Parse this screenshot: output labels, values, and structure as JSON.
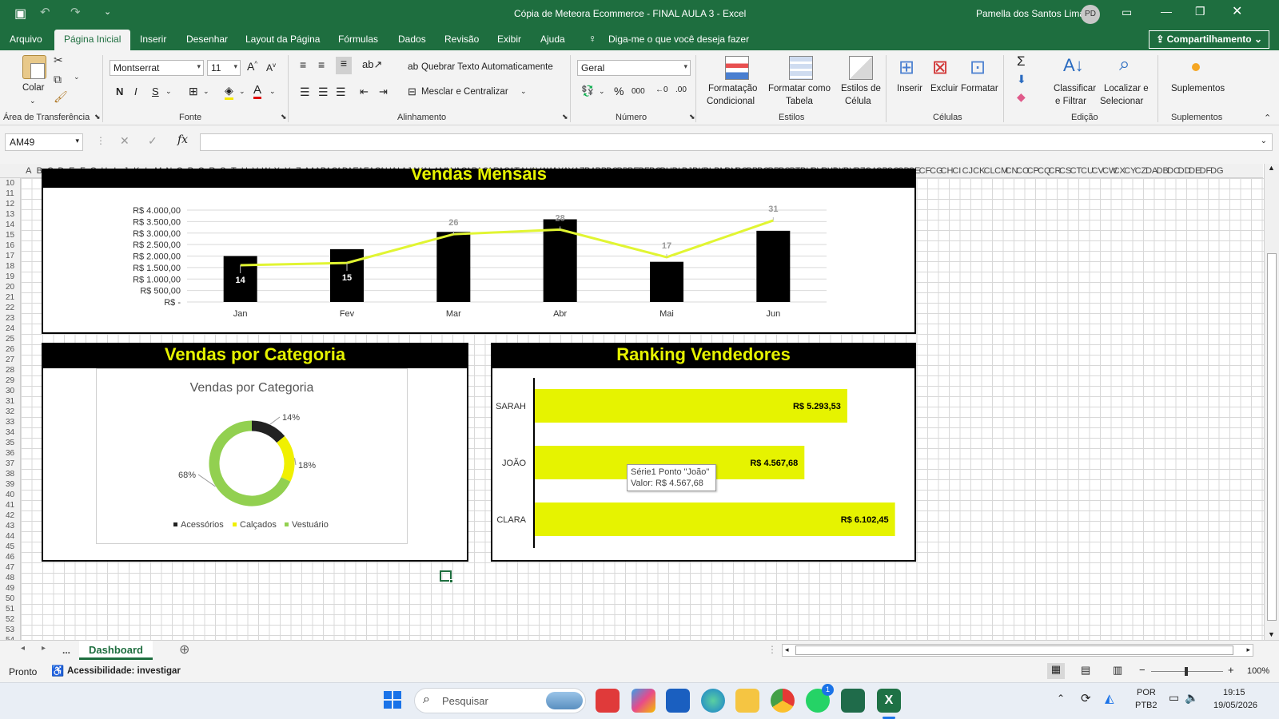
{
  "titlebar": {
    "file_title": "Cópia de Meteora Ecommerce - FINAL AULA 3  -  Excel",
    "user_name": "Pamella dos Santos Lima",
    "user_initials": "PD"
  },
  "menu": {
    "items": [
      "Arquivo",
      "Página Inicial",
      "Inserir",
      "Desenhar",
      "Layout da Página",
      "Fórmulas",
      "Dados",
      "Revisão",
      "Exibir",
      "Ajuda"
    ],
    "active": "Página Inicial",
    "tell_me": "Diga-me o que você deseja fazer",
    "share": "Compartilhamento"
  },
  "ribbon": {
    "clipboard": {
      "paste": "Colar",
      "group": "Área de Transferência"
    },
    "font": {
      "name": "Montserrat",
      "size": "11",
      "group": "Fonte"
    },
    "alignment": {
      "wrap": "Quebrar Texto Automaticamente",
      "merge": "Mesclar e Centralizar",
      "group": "Alinhamento"
    },
    "number": {
      "format": "Geral",
      "group": "Número"
    },
    "styles": {
      "conditional": "Formatação",
      "conditional2": "Condicional",
      "as_table": "Formatar como",
      "as_table2": "Tabela",
      "cell_styles": "Estilos de",
      "cell_styles2": "Célula",
      "group": "Estilos"
    },
    "cells": {
      "insert": "Inserir",
      "delete": "Excluir",
      "format": "Formatar",
      "group": "Células"
    },
    "editing": {
      "sort": "Classificar",
      "sort2": "e Filtrar",
      "find": "Localizar e",
      "find2": "Selecionar",
      "group": "Edição"
    },
    "addins": {
      "label": "Suplementos",
      "group": "Suplementos"
    }
  },
  "formula_bar": {
    "name_box": "AM49",
    "formula": ""
  },
  "columns": [
    "A",
    "B",
    "C",
    "D",
    "E",
    "F",
    "G",
    "H",
    "I",
    "J",
    "K",
    "L",
    "M",
    "N",
    "O",
    "P",
    "Q",
    "R",
    "S",
    "T",
    "U",
    "V",
    "W",
    "X",
    "Y",
    "Z",
    "AA",
    "AB",
    "AC",
    "AD",
    "AE",
    "AF",
    "AG",
    "AH",
    "AI",
    "AJ",
    "AK",
    "AL",
    "AM",
    "AN",
    "AO",
    "AP",
    "AQ",
    "AR",
    "AS",
    "AT",
    "AU",
    "AV",
    "AW",
    "AX",
    "AY",
    "AZ",
    "BA",
    "BB",
    "BC",
    "BD",
    "BE",
    "BF",
    "BG",
    "BH",
    "BI",
    "BJ",
    "BK",
    "BL",
    "BM",
    "BN",
    "BO",
    "BP",
    "BQ",
    "BR",
    "BS",
    "BT",
    "BU",
    "BV",
    "BW",
    "BX",
    "BY",
    "BZ",
    "CA",
    "CB",
    "CC",
    "CD",
    "CE",
    "CF",
    "CG",
    "CH",
    "CI",
    "CJ",
    "CK",
    "CL",
    "CM",
    "CN",
    "CO",
    "CP",
    "CQ",
    "CR",
    "CS",
    "CT",
    "CU",
    "CV",
    "CW",
    "CX",
    "CY",
    "CZ",
    "DA",
    "DB",
    "DC",
    "DD",
    "DE",
    "DF",
    "DG"
  ],
  "rows": {
    "first": 10,
    "last": 54
  },
  "colors": {
    "excel_green": "#1e6e3f",
    "lime": "#e6f300",
    "line": "#e1f532",
    "donut_black": "#222222",
    "donut_yellow": "#f0f000",
    "donut_green": "#92d050"
  },
  "chart_data": [
    {
      "type": "bar",
      "title": "Vendas Mensais",
      "categories": [
        "Jan",
        "Fev",
        "Mar",
        "Abr",
        "Mai",
        "Jun"
      ],
      "series": [],
      "values": [
        2000,
        2300,
        3050,
        3600,
        1750,
        3100
      ],
      "line_values": [
        1600,
        1700,
        2950,
        3150,
        1950,
        3550
      ],
      "line_labels": [
        "14",
        "15",
        "26",
        "28",
        "17",
        "31"
      ],
      "yticks": [
        "R$ 4.000,00",
        "R$ 3.500,00",
        "R$ 3.000,00",
        "R$ 2.500,00",
        "R$ 2.000,00",
        "R$ 1.500,00",
        "R$ 1.000,00",
        "R$ 500,00",
        "R$ -"
      ],
      "ylim": [
        0,
        4000
      ]
    },
    {
      "type": "pie",
      "title": "Vendas por Categoria",
      "panel_title": "Vendas por Categoria",
      "labels": [
        "Acessórios",
        "Calçados",
        "Vestuário"
      ],
      "values": [
        14,
        18,
        68
      ],
      "value_labels": [
        "14%",
        "18%",
        "68%"
      ]
    },
    {
      "type": "bar",
      "panel_title": "Ranking Vendedores",
      "orientation": "horizontal",
      "categories": [
        "SARAH",
        "JOÃO",
        "CLARA"
      ],
      "values": [
        5293.53,
        4567.68,
        6102.45
      ],
      "value_labels": [
        "R$ 5.293,53",
        "R$ 4.567,68",
        "R$ 6.102,45"
      ],
      "xlim": [
        0,
        6500
      ],
      "tooltip": {
        "line1": "Série1 Ponto \"João\"",
        "line2": "Valor:  R$ 4.567,68"
      }
    }
  ],
  "sheet": {
    "ellipsis": "...",
    "active_tab": "Dashboard"
  },
  "status": {
    "ready": "Pronto",
    "accessibility": "Acessibilidade: investigar",
    "zoom": "100%"
  },
  "taskbar": {
    "search": "Pesquisar",
    "lang1": "POR",
    "lang2": "PTB2",
    "time": "19:15",
    "date": "19/05/2026",
    "whatsapp_badge": "1"
  }
}
